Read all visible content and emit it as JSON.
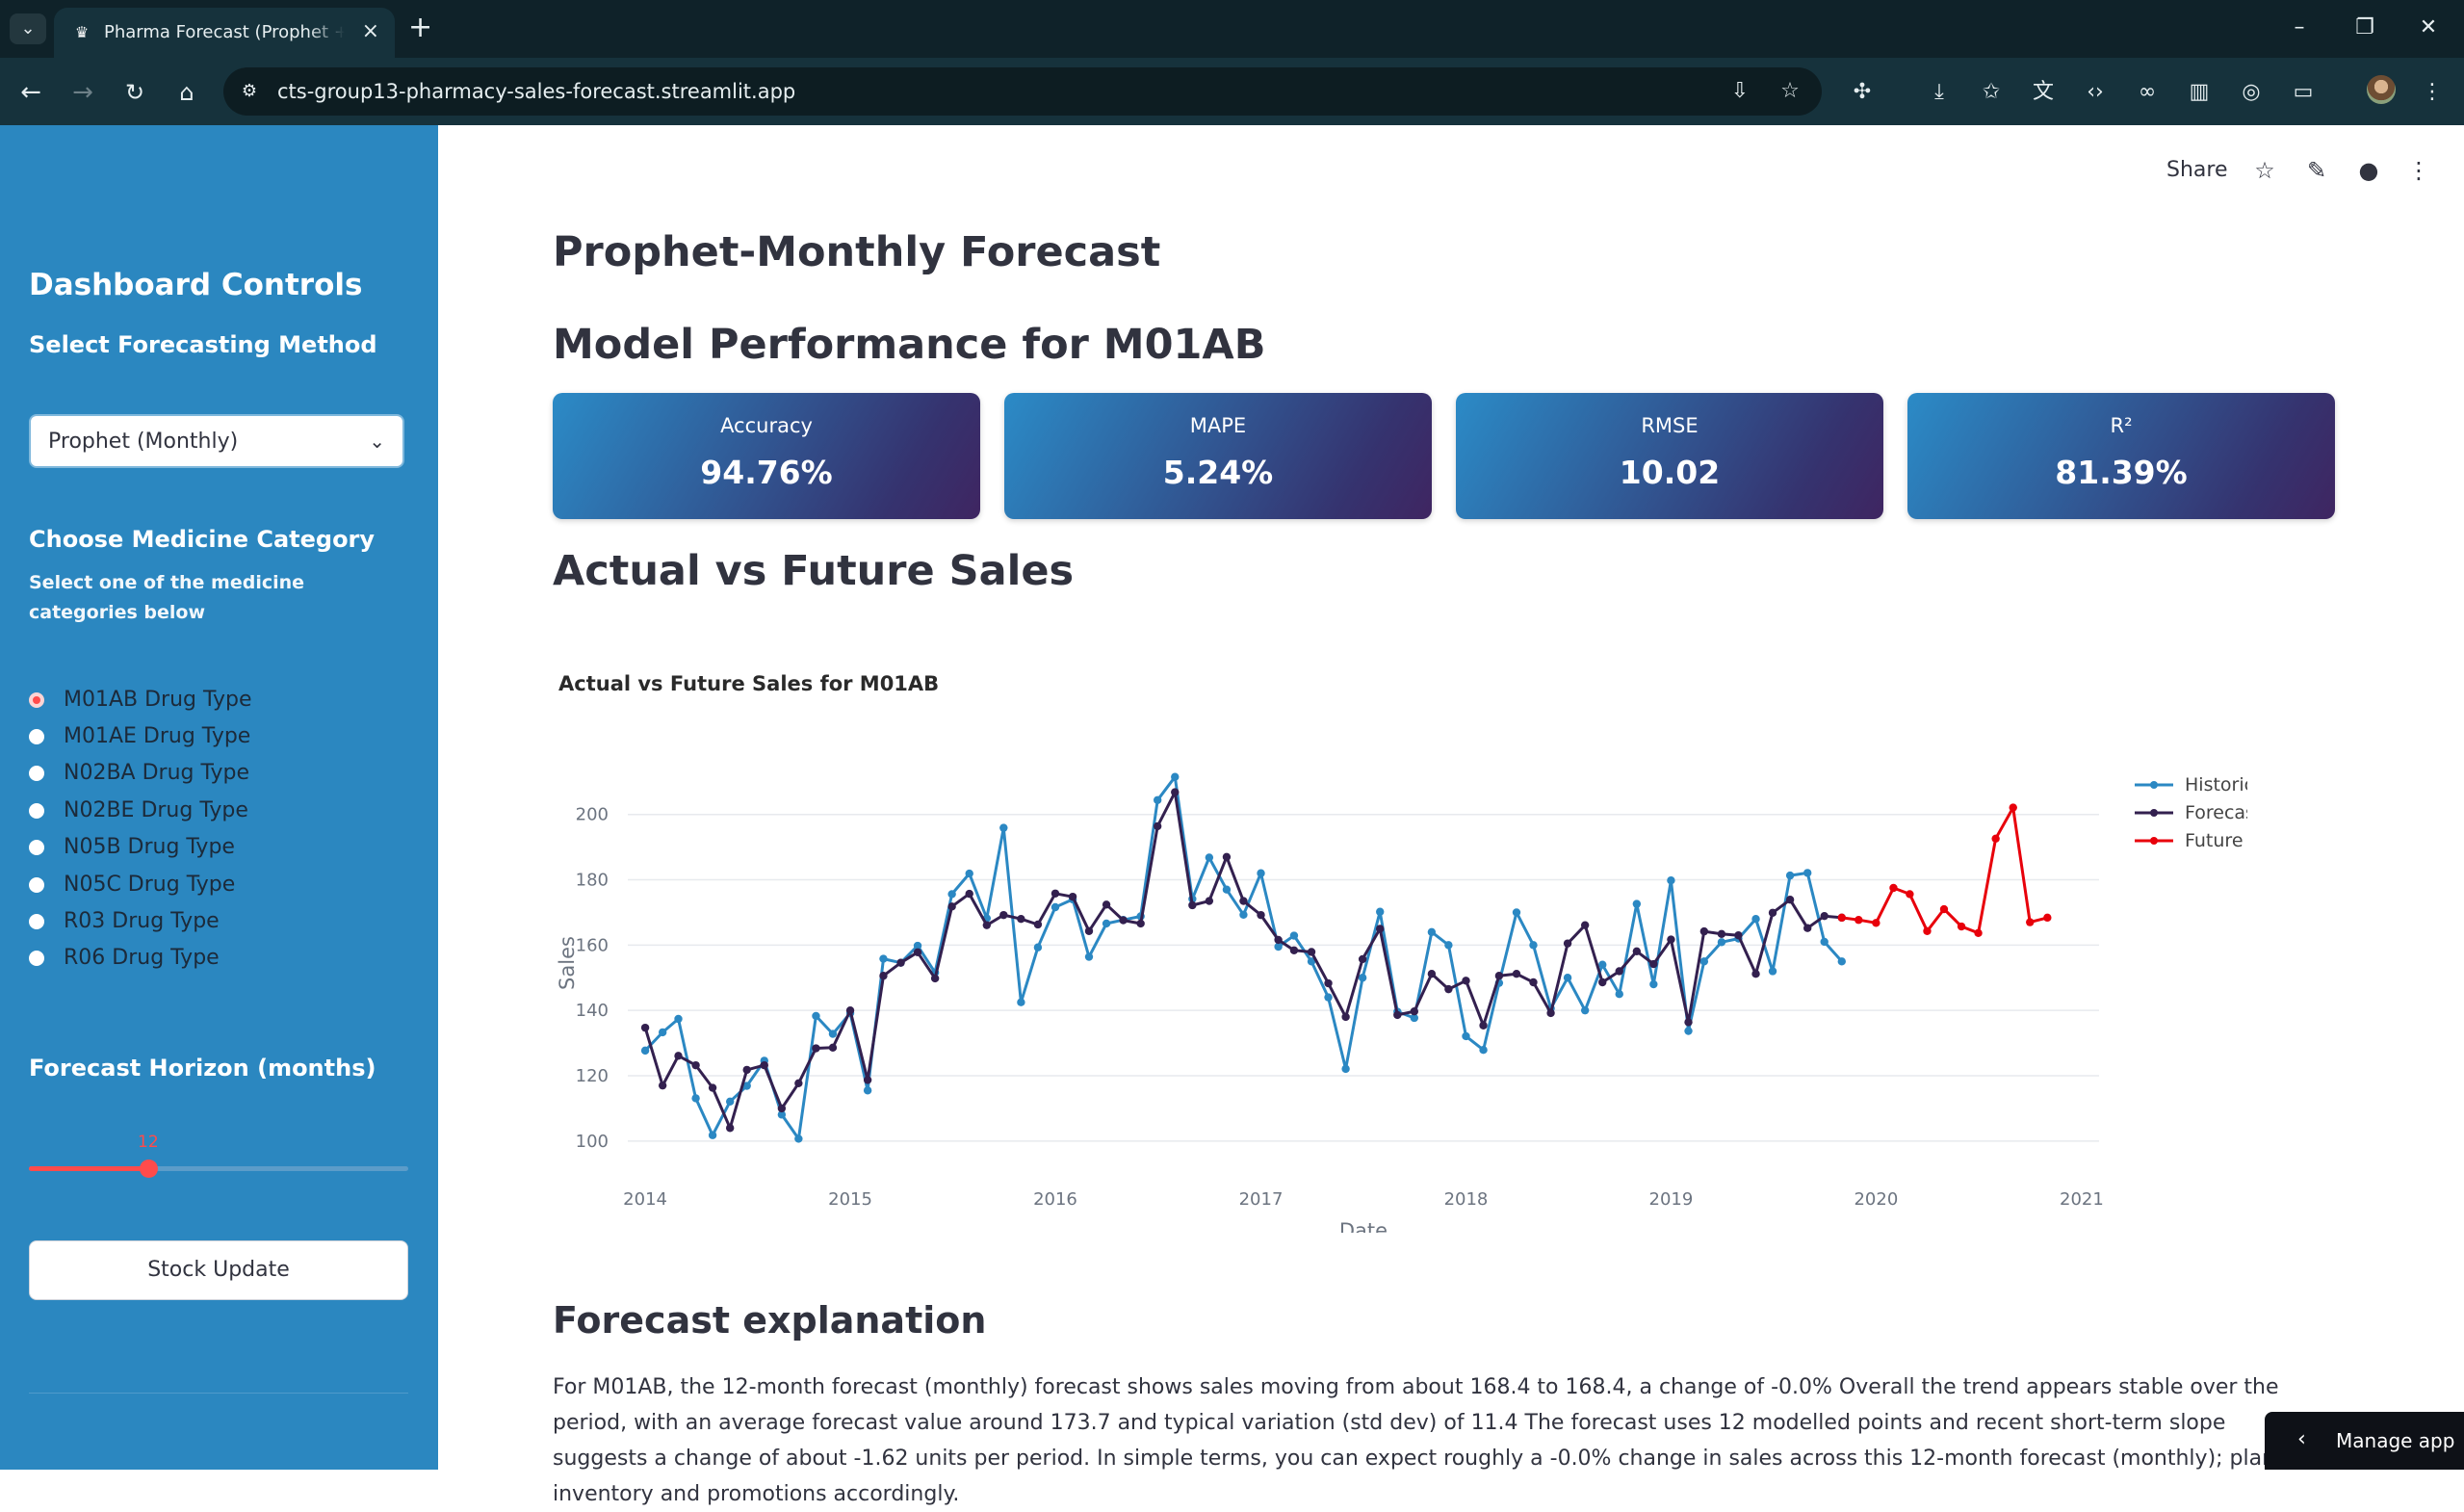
{
  "browser": {
    "tab_title": "Pharma Forecast (Prophet + XGBoost)",
    "url": "cts-group13-pharmacy-sales-forecast.streamlit.app"
  },
  "sidebar": {
    "title": "Dashboard Controls",
    "method_heading": "Select Forecasting Method",
    "method_value": "Prophet (Monthly)",
    "category_heading": "Choose Medicine Category",
    "category_help": "Select one of the medicine categories below",
    "categories": [
      {
        "label": "M01AB Drug Type",
        "selected": true
      },
      {
        "label": "M01AE Drug Type",
        "selected": false
      },
      {
        "label": "N02BA Drug Type",
        "selected": false
      },
      {
        "label": "N02BE Drug Type",
        "selected": false
      },
      {
        "label": "N05B Drug Type",
        "selected": false
      },
      {
        "label": "N05C Drug Type",
        "selected": false
      },
      {
        "label": "R03 Drug Type",
        "selected": false
      },
      {
        "label": "R06 Drug Type",
        "selected": false
      }
    ],
    "horizon_heading": "Forecast Horizon (months)",
    "horizon_value": "12",
    "horizon_fraction": 0.31,
    "stock_button": "Stock Update"
  },
  "header": {
    "share": "Share"
  },
  "main": {
    "title": "Prophet-Monthly Forecast",
    "performance_heading": "Model Performance for M01AB",
    "metrics": [
      {
        "label": "Accuracy",
        "value": "94.76%"
      },
      {
        "label": "MAPE",
        "value": "5.24%"
      },
      {
        "label": "RMSE",
        "value": "10.02"
      },
      {
        "label": "R²",
        "value": "81.39%"
      }
    ],
    "sales_heading": "Actual vs Future Sales",
    "explanation_heading": "Forecast explanation",
    "explanation_text": "For M01AB, the 12-month forecast (monthly) forecast shows sales moving from about 168.4 to 168.4, a change of -0.0% Overall the trend appears stable over the period, with an average forecast value around 173.7 and typical variation (std dev) of 11.4 The forecast uses 12 modelled points and recent short-term slope suggests a change of about -1.62 units per period. In simple terms, you can expect roughly a -0.0% change in sales across this 12-month forecast (monthly); plan inventory and promotions accordingly."
  },
  "manage_app": "Manage app",
  "colors": {
    "historical": "#2b88c3",
    "forecast": "#33204f",
    "future": "#e8000b",
    "sidebar": "#2b87c0",
    "accent": "#ff4b4b"
  },
  "chart_data": {
    "type": "line",
    "title": "Actual vs Future Sales for M01AB",
    "xlabel": "Date",
    "ylabel": "Sales",
    "xlim": [
      "2013-12-01",
      "2021-02-01"
    ],
    "ylim": [
      97,
      212
    ],
    "y_ticks": [
      100,
      120,
      140,
      160,
      180,
      200
    ],
    "x_ticks": [
      "2014",
      "2015",
      "2016",
      "2017",
      "2018",
      "2019",
      "2020",
      "2021"
    ],
    "grid": true,
    "legend_position": "top-right",
    "series": [
      {
        "name": "Historical Actual",
        "x_start": "2014-01",
        "values": [
          127.7,
          133.3,
          137.4,
          113.1,
          101.8,
          112.1,
          116.9,
          124.6,
          108.1,
          100.7,
          138.3,
          132.8,
          139.2,
          115.5,
          155.8,
          154.6,
          159.8,
          151.6,
          175.6,
          181.9,
          168.2,
          195.9,
          142.5,
          159.3,
          171.6,
          174.0,
          156.4,
          166.6,
          167.7,
          168.8,
          204.4,
          211.5,
          174.1,
          186.8,
          177.0,
          169.3,
          182.0,
          159.5,
          162.9,
          155.0,
          144.0,
          122.1,
          150.0,
          170.2,
          139.6,
          137.7,
          164.0,
          160.0,
          132.1,
          127.9,
          148.4,
          170.0,
          160.0,
          140.6,
          150.0,
          140.0,
          154.0,
          145.0,
          172.6,
          148.0,
          179.8,
          133.7,
          155.0,
          160.9,
          162.0,
          168.0,
          152.0,
          181.3,
          182.1,
          161.0,
          155.0
        ]
      },
      {
        "name": "Forecast",
        "x_start": "2014-01",
        "values": [
          134.7,
          117.0,
          126.1,
          123.2,
          116.3,
          104.0,
          121.8,
          123.2,
          110.0,
          117.7,
          128.4,
          128.6,
          140.0,
          118.7,
          150.6,
          154.6,
          157.8,
          149.8,
          171.8,
          175.7,
          166.1,
          169.2,
          168.0,
          166.3,
          175.8,
          174.8,
          164.3,
          172.4,
          167.6,
          166.6,
          196.4,
          206.8,
          172.2,
          173.5,
          187.0,
          173.5,
          169.2,
          161.6,
          158.4,
          157.9,
          148.3,
          138.0,
          155.7,
          165.0,
          138.6,
          139.7,
          151.2,
          146.5,
          149.1,
          135.4,
          150.6,
          151.2,
          148.6,
          139.2,
          160.5,
          166.1,
          148.6,
          152.0,
          158.1,
          154.2,
          161.7,
          136.4,
          164.2,
          163.4,
          163.0,
          151.2,
          169.9,
          173.9,
          165.2,
          168.9,
          168.4
        ]
      },
      {
        "name": "Future Forecast",
        "x_start": "2019-11",
        "values": [
          168.4,
          167.7,
          166.8,
          177.5,
          175.6,
          164.3,
          171.0,
          165.7,
          163.7,
          192.6,
          202.1,
          167.0,
          168.4
        ]
      }
    ]
  }
}
